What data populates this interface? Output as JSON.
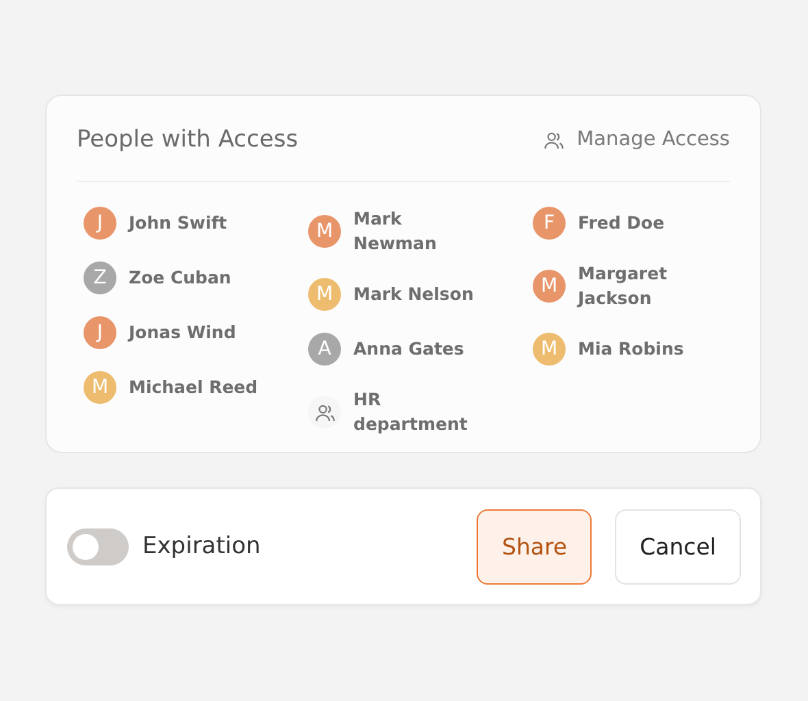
{
  "access": {
    "title": "People with Access",
    "manage_label": "Manage Access",
    "columns": [
      [
        {
          "kind": "person",
          "initial": "J",
          "name": "John Swift",
          "color": "#e8956a"
        },
        {
          "kind": "person",
          "initial": "Z",
          "name": "Zoe Cuban",
          "color": "#a8a8a8"
        },
        {
          "kind": "person",
          "initial": "J",
          "name": "Jonas Wind",
          "color": "#e8956a"
        },
        {
          "kind": "person",
          "initial": "M",
          "name": "Michael Reed",
          "color": "#edbc6e"
        }
      ],
      [
        {
          "kind": "person",
          "initial": "M",
          "name": "Mark Newman",
          "color": "#e8956a"
        },
        {
          "kind": "person",
          "initial": "M",
          "name": "Mark Nelson",
          "color": "#edbc6e"
        },
        {
          "kind": "person",
          "initial": "A",
          "name": "Anna Gates",
          "color": "#a8a8a8"
        },
        {
          "kind": "group",
          "name": "HR department"
        }
      ],
      [
        {
          "kind": "person",
          "initial": "F",
          "name": "Fred Doe",
          "color": "#e8956a"
        },
        {
          "kind": "person",
          "initial": "M",
          "name": "Margaret Jackson",
          "color": "#e8956a"
        },
        {
          "kind": "person",
          "initial": "M",
          "name": "Mia Robins",
          "color": "#edbc6e"
        }
      ]
    ]
  },
  "footer": {
    "expiration": {
      "label": "Expiration",
      "on": false
    },
    "buttons": [
      {
        "label": "Share",
        "kind": "primary"
      },
      {
        "label": "Cancel",
        "kind": "secondary"
      }
    ]
  }
}
